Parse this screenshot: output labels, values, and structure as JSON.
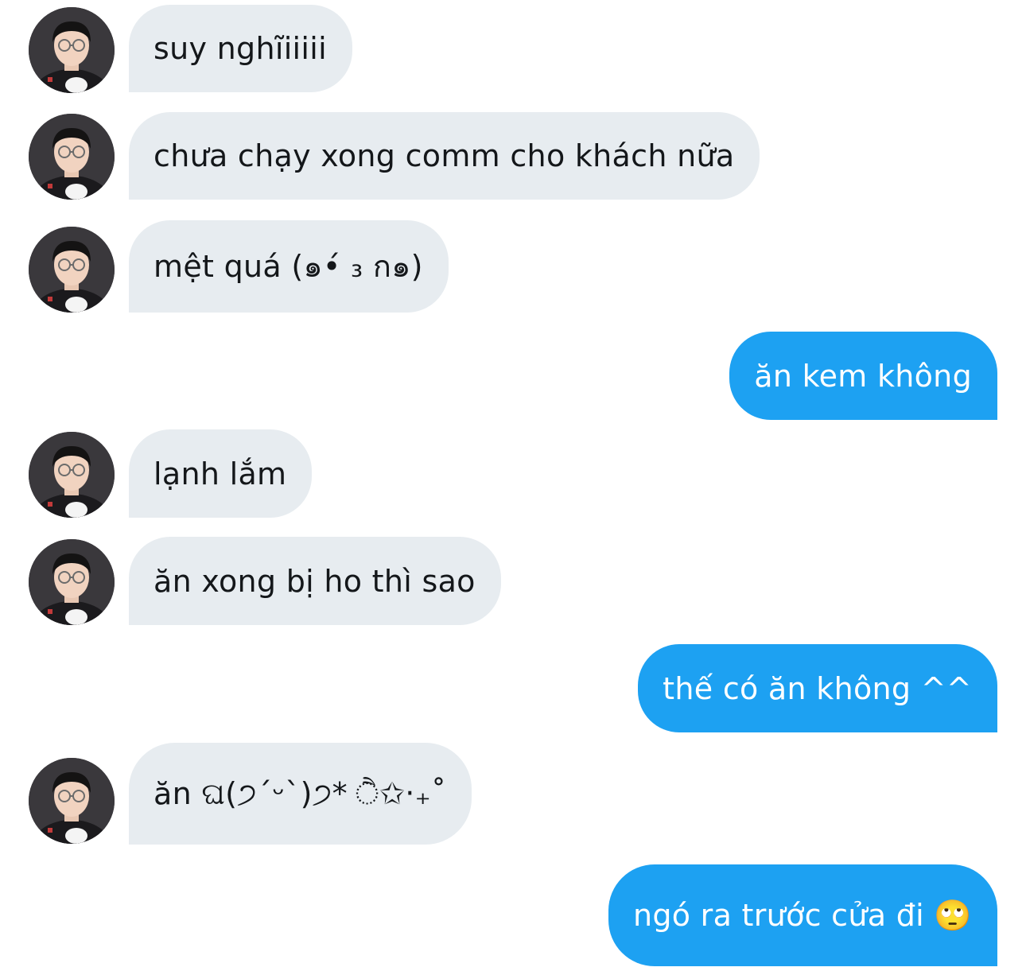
{
  "conversation": {
    "messages": [
      {
        "direction": "incoming",
        "text": "suy nghĩiiiii",
        "has_avatar": true
      },
      {
        "direction": "incoming",
        "text": "chưa chạy xong comm cho khách nữa",
        "has_avatar": true
      },
      {
        "direction": "incoming",
        "text": "mệt quá (๑•́ ₃ ก๑)",
        "has_avatar": true
      },
      {
        "direction": "outgoing",
        "text": "ăn kem không"
      },
      {
        "direction": "incoming",
        "text": "lạnh lắm",
        "has_avatar": true
      },
      {
        "direction": "incoming",
        "text": "ăn xong bị ho thì sao",
        "has_avatar": true
      },
      {
        "direction": "outgoing",
        "text": "thế có ăn không ^^"
      },
      {
        "direction": "incoming",
        "text": "ăn ଘ(੭ˊᵕˋ)੭* ੈ✩‧₊˚",
        "has_avatar": true
      },
      {
        "direction": "outgoing",
        "text": "ngó ra trước cửa đi 🙄"
      }
    ]
  },
  "colors": {
    "incoming_bubble": "#e7ecf0",
    "outgoing_bubble": "#1da1f2",
    "incoming_text": "#14171a",
    "outgoing_text": "#ffffff"
  }
}
